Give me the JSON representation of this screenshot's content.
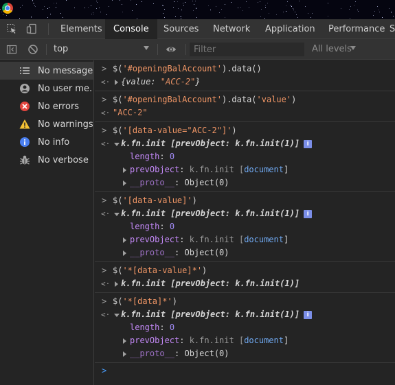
{
  "tabs": [
    {
      "label": "Elements"
    },
    {
      "label": "Console"
    },
    {
      "label": "Sources"
    },
    {
      "label": "Network"
    },
    {
      "label": "Application"
    },
    {
      "label": "Performance"
    }
  ],
  "toolbar": {
    "context": "top",
    "filter_placeholder": "Filter",
    "levels": "All levels"
  },
  "sidebar": {
    "items": [
      {
        "label": "No messages",
        "icon": "list-icon"
      },
      {
        "label": "No user me...",
        "icon": "user-icon"
      },
      {
        "label": "No errors",
        "icon": "error-icon"
      },
      {
        "label": "No warnings",
        "icon": "warning-icon"
      },
      {
        "label": "No info",
        "icon": "info-icon"
      },
      {
        "label": "No verbose",
        "icon": "bug-icon"
      }
    ]
  },
  "console": {
    "e1": {
      "cmd_a": "$(",
      "cmd_str": "'#openingBalAccount'",
      "cmd_b": ").data()",
      "res_a": "{value: ",
      "res_str": "\"ACC-2\"",
      "res_b": "}"
    },
    "e2": {
      "cmd_a": "$(",
      "cmd_str": "'#openingBalAccount'",
      "cmd_b": ").data(",
      "cmd_str2": "'value'",
      "cmd_c": ")",
      "res": "\"ACC-2\""
    },
    "e3": {
      "cmd_a": "$(",
      "cmd_str": "'[data-value=\"ACC-2\"]'",
      "cmd_b": ")",
      "head_a": "k.fn.init [",
      "head_key": "prevObject",
      "head_b": ": k.fn.init(1)]",
      "len_key": "length",
      "len_val": "0",
      "prev_key": "prevObject",
      "prev_a": "k.fn.init [",
      "prev_doc": "document",
      "prev_b": "]",
      "proto_key": "__proto__",
      "proto_val": "Object(0)"
    },
    "e4": {
      "cmd_a": "$(",
      "cmd_str": "'[data-value]'",
      "cmd_b": ")",
      "head_a": "k.fn.init [",
      "head_key": "prevObject",
      "head_b": ": k.fn.init(1)]",
      "len_key": "length",
      "len_val": "0",
      "prev_key": "prevObject",
      "prev_a": "k.fn.init [",
      "prev_doc": "document",
      "prev_b": "]",
      "proto_key": "__proto__",
      "proto_val": "Object(0)"
    },
    "e5": {
      "cmd_a": "$(",
      "cmd_str": "'*[data-value]*'",
      "cmd_b": ")",
      "head_a": "k.fn.init [",
      "head_key": "prevObject",
      "head_b": ": k.fn.init(1)]"
    },
    "e6": {
      "cmd_a": "$(",
      "cmd_str": "'*[data]*'",
      "cmd_b": ")",
      "head_a": "k.fn.init [",
      "head_key": "prevObject",
      "head_b": ": k.fn.init(1)]",
      "len_key": "length",
      "len_val": "0",
      "prev_key": "prevObject",
      "prev_a": "k.fn.init [",
      "prev_doc": "document",
      "prev_b": "]",
      "proto_key": "__proto__",
      "proto_val": "Object(0)"
    },
    "info_badge": "i",
    "prompt": ">",
    "return": "<·"
  }
}
